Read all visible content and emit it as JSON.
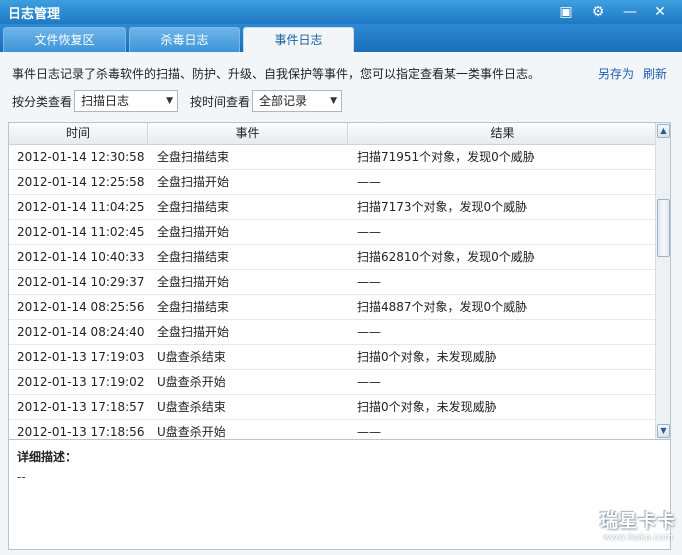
{
  "window": {
    "title": "日志管理",
    "controls": [
      "▣",
      "⚙",
      "—",
      "✕"
    ]
  },
  "tabs": [
    {
      "label": "文件恢复区",
      "active": false
    },
    {
      "label": "杀毒日志",
      "active": false
    },
    {
      "label": "事件日志",
      "active": true
    }
  ],
  "description": "事件日志记录了杀毒软件的扫描、防护、升级、自我保护等事件，您可以指定查看某一类事件日志。",
  "actions": {
    "save_as": "另存为",
    "refresh": "刷新"
  },
  "filters": {
    "category_label": "按分类查看",
    "category_value": "扫描日志",
    "time_label": "按时间查看",
    "time_value": "全部记录"
  },
  "table": {
    "columns": [
      "时间",
      "事件",
      "结果"
    ],
    "rows": [
      [
        "2012-01-14 12:30:58",
        "全盘扫描结束",
        "扫描71951个对象，发现0个威胁"
      ],
      [
        "2012-01-14 12:25:58",
        "全盘扫描开始",
        "——"
      ],
      [
        "2012-01-14 11:04:25",
        "全盘扫描结束",
        "扫描7173个对象，发现0个威胁"
      ],
      [
        "2012-01-14 11:02:45",
        "全盘扫描开始",
        "——"
      ],
      [
        "2012-01-14 10:40:33",
        "全盘扫描结束",
        "扫描62810个对象，发现0个威胁"
      ],
      [
        "2012-01-14 10:29:37",
        "全盘扫描开始",
        "——"
      ],
      [
        "2012-01-14 08:25:56",
        "全盘扫描结束",
        "扫描4887个对象，发现0个威胁"
      ],
      [
        "2012-01-14 08:24:40",
        "全盘扫描开始",
        "——"
      ],
      [
        "2012-01-13 17:19:03",
        "U盘查杀结束",
        "扫描0个对象，未发现威胁"
      ],
      [
        "2012-01-13 17:19:02",
        "U盘查杀开始",
        "——"
      ],
      [
        "2012-01-13 17:18:57",
        "U盘查杀结束",
        "扫描0个对象，未发现威胁"
      ],
      [
        "2012-01-13 17:18:56",
        "U盘查杀开始",
        "——"
      ]
    ]
  },
  "detail": {
    "label": "详细描述：",
    "value": "--"
  },
  "watermark": {
    "main": "瑞星卡卡",
    "sub": "www.ikaka.com"
  }
}
